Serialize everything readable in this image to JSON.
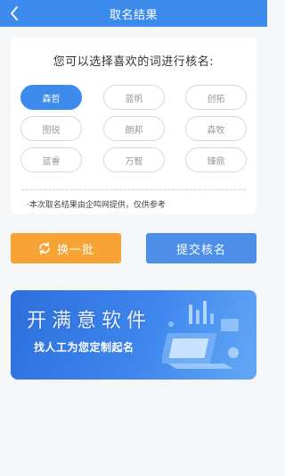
{
  "header": {
    "title": "取名结果"
  },
  "card": {
    "heading": "您可以选择喜欢的词进行核名:",
    "names": [
      "森哲",
      "蓝帆",
      "创拓",
      "图锐",
      "朗邦",
      "森牧",
      "蓝睿",
      "万智",
      "臻鼎"
    ],
    "selected_name": "森哲",
    "disclaimer": "·本次取名结果由企鸣网提供，仅供参考"
  },
  "actions": {
    "refresh_label": "换一批",
    "submit_label": "提交核名"
  },
  "banner": {
    "title": "开满意软件",
    "subtitle": "找人工为您定制起名"
  },
  "colors": {
    "primary": "#3d8bec",
    "orange": "#f7a336",
    "submit": "#4d8ee9",
    "background": "#f5f6f8"
  }
}
